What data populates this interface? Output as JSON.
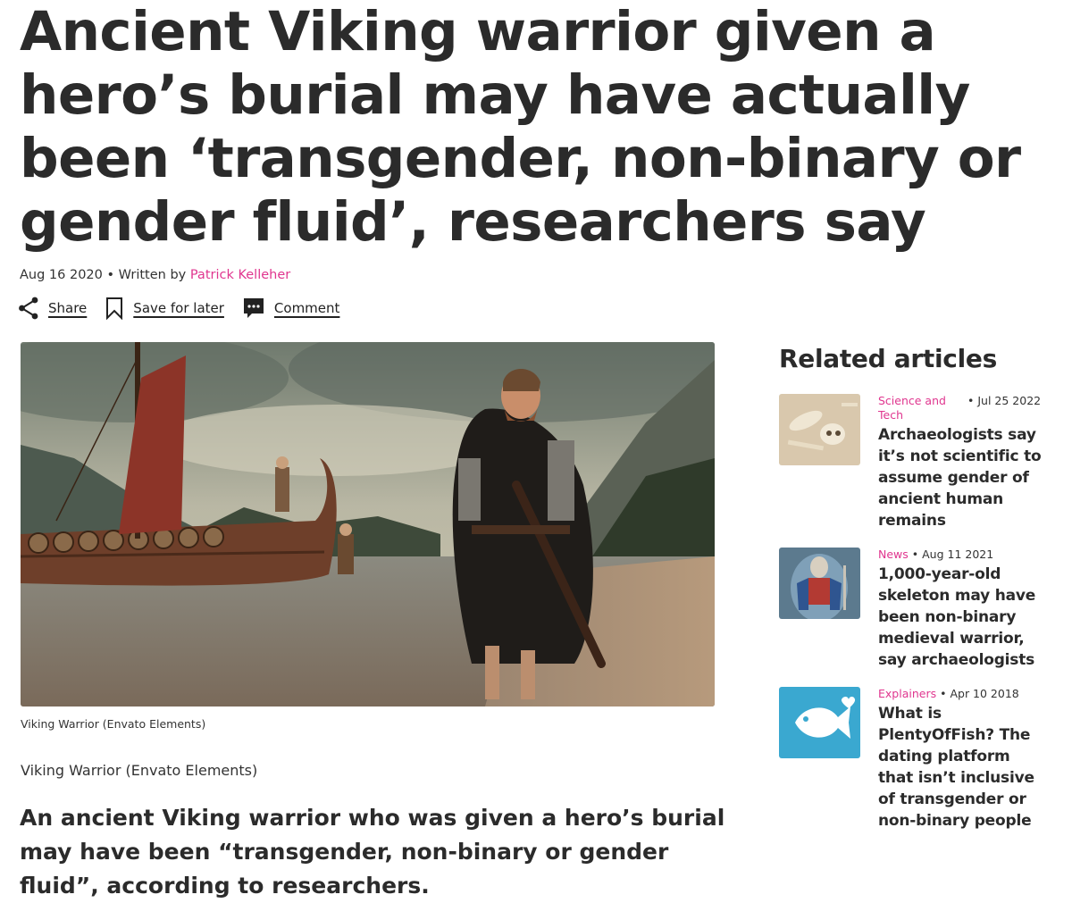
{
  "article": {
    "headline": "Ancient Viking warrior given a hero’s burial may have actually been ‘transgender, non-binary or gender fluid’, researchers say",
    "date": "Aug 16 2020",
    "byline_prefix": "Written by",
    "author": "Patrick Kelleher",
    "hero_caption_small": "Viking Warrior (Envato Elements)",
    "hero_caption_large": "Viking Warrior (Envato Elements)",
    "lede": "An ancient Viking warrior who was given a hero’s burial may have been “transgender, non-binary or gender fluid”, according to researchers."
  },
  "actions": {
    "share": "Share",
    "save": "Save for later",
    "comment": "Comment",
    "share_icon": "share-icon",
    "save_icon": "bookmark-icon",
    "comment_icon": "comment-icon"
  },
  "related": {
    "heading": "Related articles",
    "items": [
      {
        "category": "Science and Tech",
        "date": "Jul 25 2022",
        "title": "Archaeologists say it’s not scientific to assume gender of ancient human remains"
      },
      {
        "category": "News",
        "date": "Aug 11 2021",
        "title": "1,000-year-old skeleton may have been non-binary medieval warrior, say archaeologists"
      },
      {
        "category": "Explainers",
        "date": "Apr 10 2018",
        "title": "What is PlentyOfFish? The dating platform that isn’t inclusive of transgender or non-binary people"
      }
    ]
  },
  "colors": {
    "accent": "#e0368f",
    "text": "#2b2b2b",
    "background": "#ffffff"
  }
}
